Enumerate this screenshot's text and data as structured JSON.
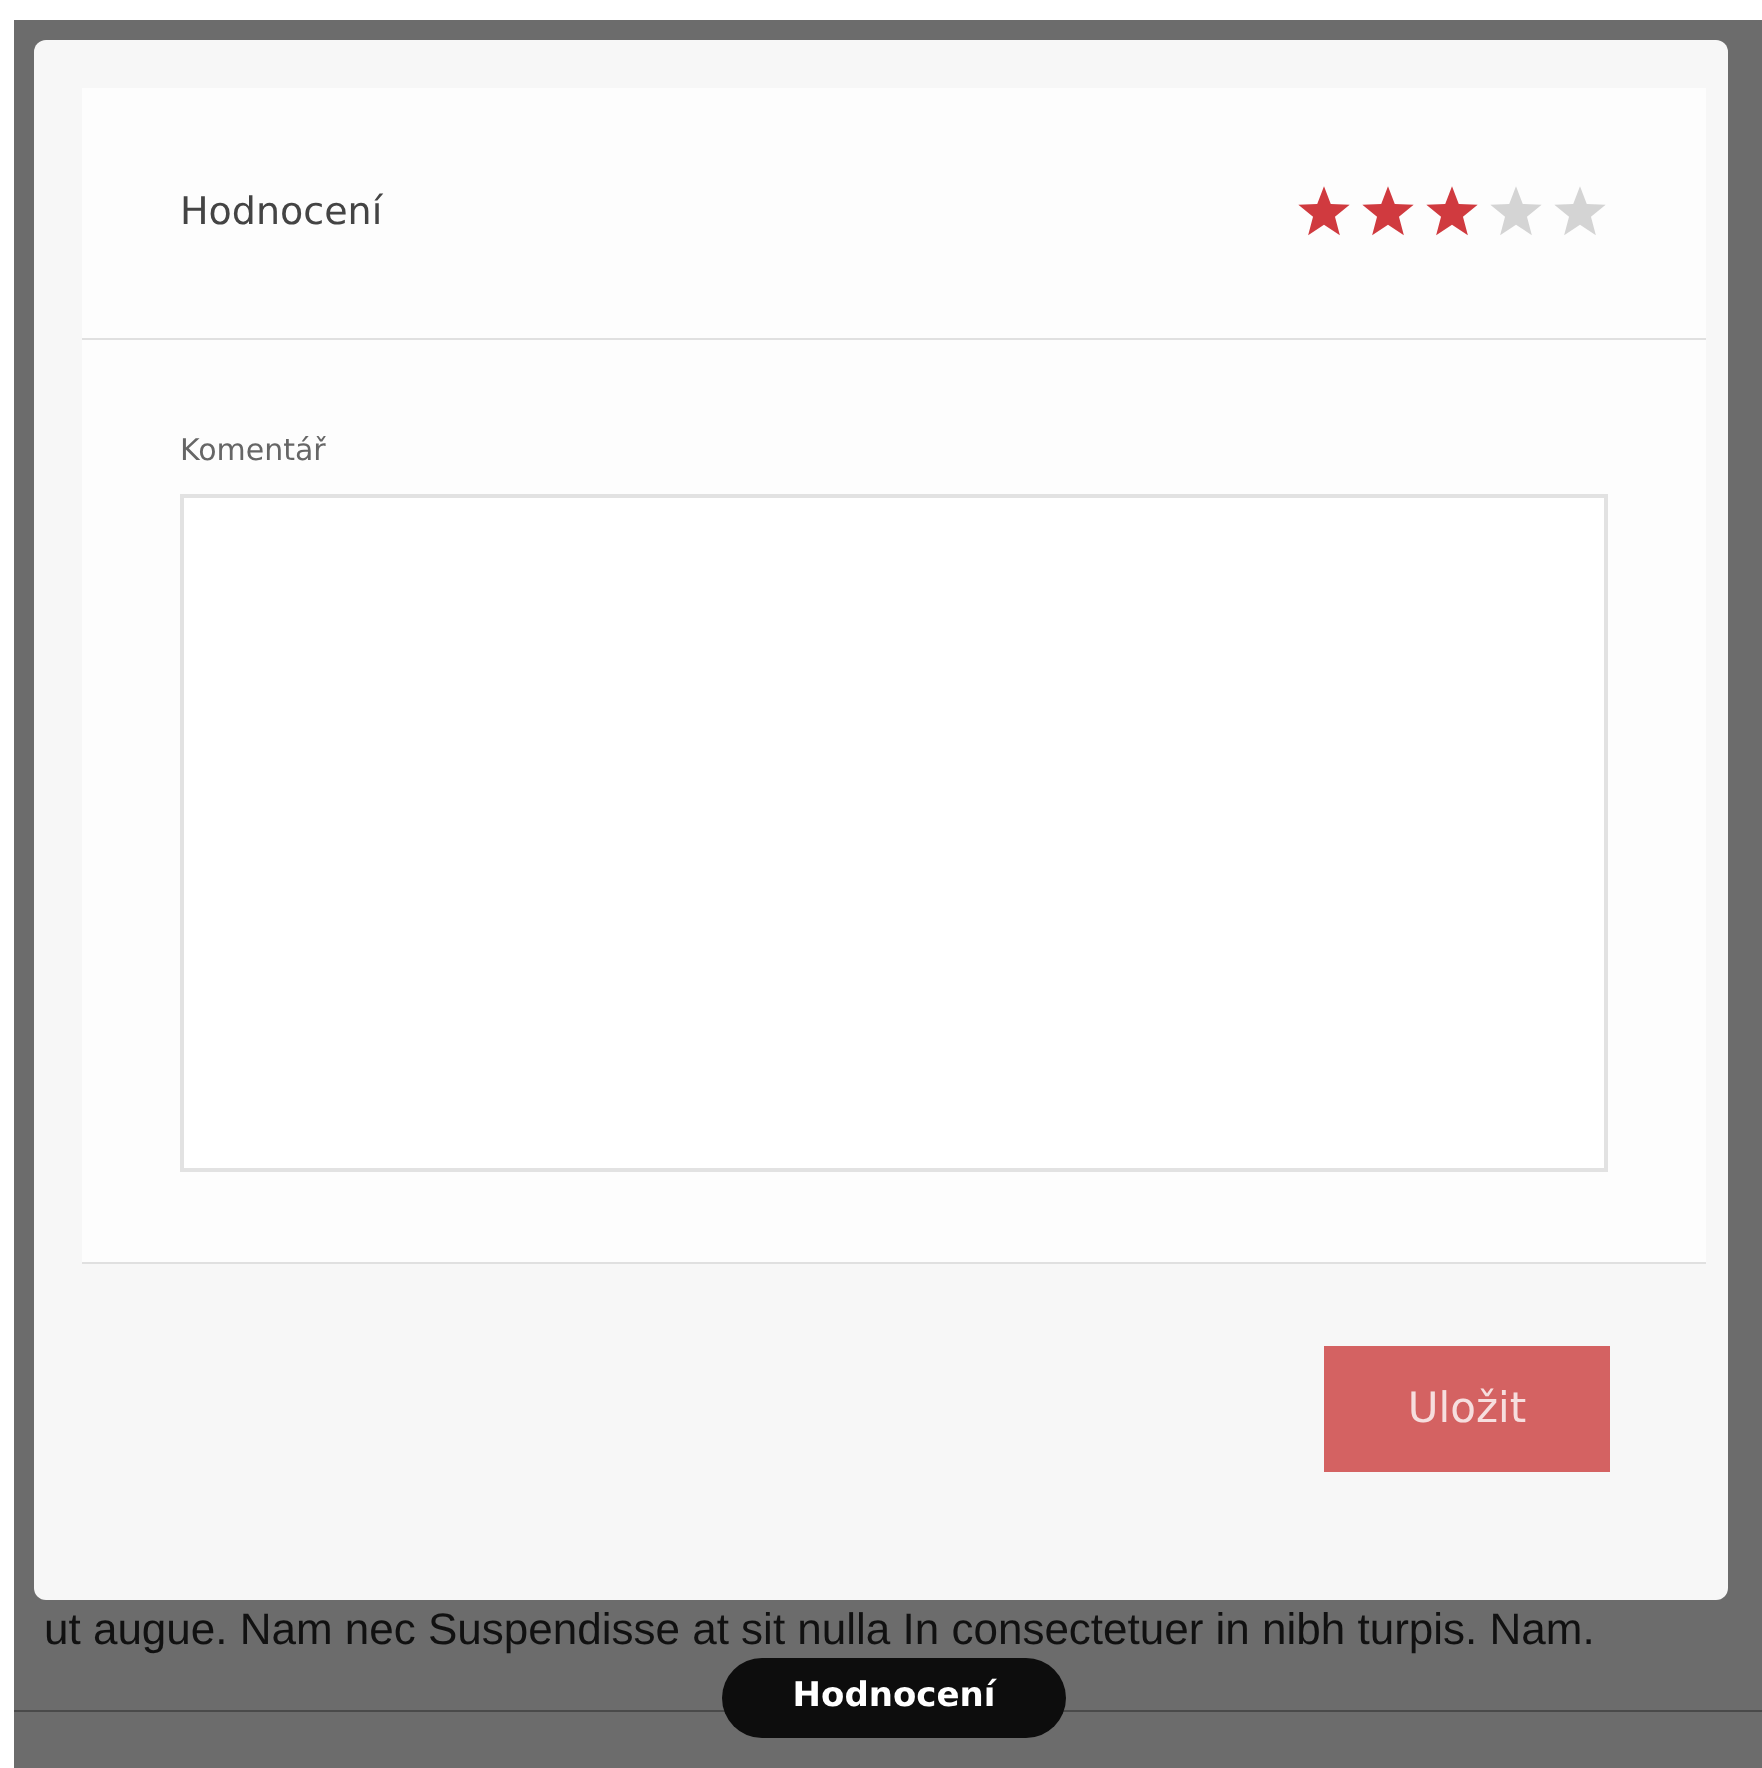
{
  "dialog": {
    "title": "Hodnocení",
    "stars": 3,
    "comment": {
      "label": "Komentář"
    },
    "buttons": [
      {
        "label": "Uložit",
        "kind": "primary"
      }
    ]
  },
  "background_text": "ut augue. Nam nec Suspendisse at sit nulla In consectetuer in nibh turpis. Nam.",
  "tooltip": "Hodnocení"
}
